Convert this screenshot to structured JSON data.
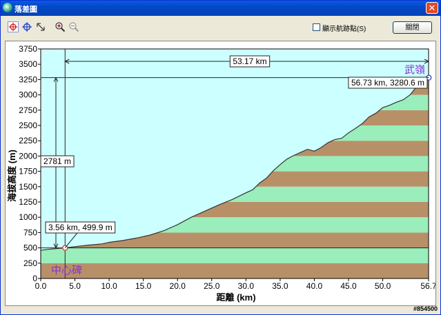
{
  "window": {
    "title": "落差圖",
    "close_glyph": "✕"
  },
  "toolbar": {
    "tools": [
      "crosshair-red-icon",
      "crosshair-blue-icon",
      "pan-icon",
      "zoom-in-icon",
      "zoom-out-icon"
    ],
    "show_waypoints_label": "顯示航跡點(S)",
    "close_button_label": "關閉"
  },
  "colors": {
    "sky": "#ccffff",
    "stripe_green": "#99eebb",
    "stripe_brown": "#b89068",
    "profile_line": "#333333",
    "station_label": "#8833cc"
  },
  "chart_data": {
    "type": "area",
    "xlabel": "距離  (km)",
    "ylabel": "海拔高度 (m)",
    "xlim": [
      0,
      56.7
    ],
    "ylim": [
      0,
      3750
    ],
    "x_ticks": [
      "0.0",
      "5.0",
      "10.0",
      "15.0",
      "20.0",
      "25.0",
      "30.0",
      "35.0",
      "40.0",
      "45.0",
      "50.0",
      "56.7"
    ],
    "y_ticks": [
      "0",
      "250",
      "500",
      "750",
      "1000",
      "1250",
      "1500",
      "1750",
      "2000",
      "2250",
      "2500",
      "2750",
      "3000",
      "3250",
      "3500",
      "3750"
    ],
    "profile": [
      [
        0,
        460
      ],
      [
        1,
        475
      ],
      [
        2,
        485
      ],
      [
        3,
        495
      ],
      [
        3.56,
        499.9
      ],
      [
        5,
        520
      ],
      [
        7,
        545
      ],
      [
        9,
        565
      ],
      [
        10,
        590
      ],
      [
        12,
        620
      ],
      [
        14,
        660
      ],
      [
        16,
        710
      ],
      [
        18,
        780
      ],
      [
        20,
        880
      ],
      [
        22,
        1000
      ],
      [
        24,
        1100
      ],
      [
        26,
        1200
      ],
      [
        28,
        1290
      ],
      [
        30,
        1400
      ],
      [
        31,
        1450
      ],
      [
        32,
        1560
      ],
      [
        33,
        1640
      ],
      [
        34,
        1760
      ],
      [
        35,
        1860
      ],
      [
        36,
        1950
      ],
      [
        37,
        2010
      ],
      [
        38,
        2060
      ],
      [
        39,
        2110
      ],
      [
        40,
        2080
      ],
      [
        41,
        2140
      ],
      [
        42,
        2220
      ],
      [
        43,
        2270
      ],
      [
        44,
        2290
      ],
      [
        45,
        2380
      ],
      [
        46,
        2450
      ],
      [
        47,
        2530
      ],
      [
        48,
        2640
      ],
      [
        49,
        2700
      ],
      [
        50,
        2790
      ],
      [
        51,
        2830
      ],
      [
        52,
        2880
      ],
      [
        53,
        2920
      ],
      [
        54,
        3000
      ],
      [
        55,
        3140
      ],
      [
        56,
        3230
      ],
      [
        56.73,
        3280.6
      ]
    ],
    "start_label": "中心碑",
    "end_label": "武嶺",
    "start_point_label": "3.56 km, 499.9 m",
    "end_point_label": "56.73 km, 3280.6 m",
    "distance_label": "53.17 km",
    "elevation_diff_label": "2781 m"
  },
  "status": {
    "id": "#854500"
  }
}
